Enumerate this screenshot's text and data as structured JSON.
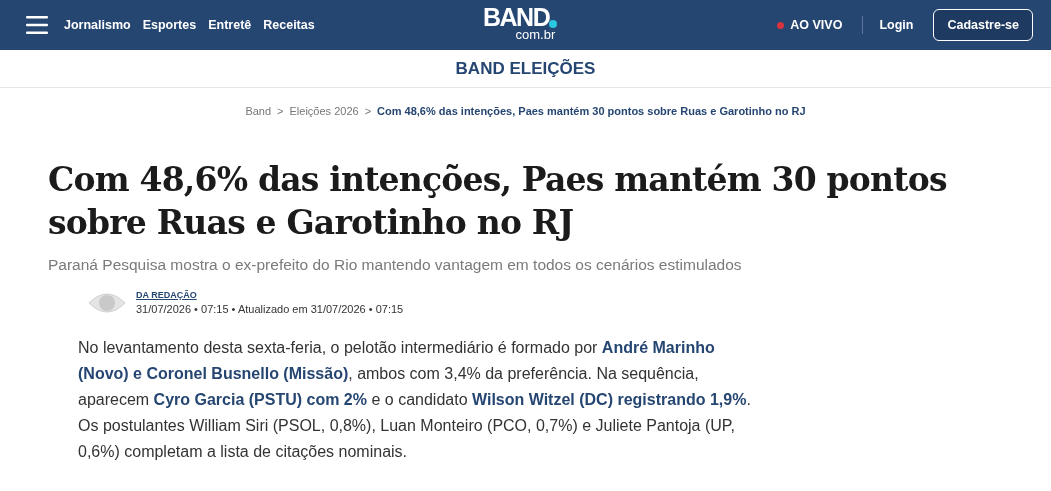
{
  "header": {
    "nav": [
      "Jornalismo",
      "Esportes",
      "Entretê",
      "Receitas"
    ],
    "logo": {
      "name": "BAND",
      "domain": "com.br"
    },
    "live": "AO VIVO",
    "login": "Login",
    "signup": "Cadastre-se"
  },
  "section": "BAND ELEIÇÕES",
  "breadcrumb": [
    {
      "label": "Band",
      "current": false
    },
    {
      "label": "Eleições 2026",
      "current": false
    },
    {
      "label": "Com 48,6% das intenções, Paes mantém 30 pontos sobre Ruas e Garotinho no RJ",
      "current": true
    }
  ],
  "breadcrumb_separator": ">",
  "article": {
    "title": "Com 48,6% das intenções, Paes mantém 30 pontos sobre Ruas e Garotinho no RJ",
    "subtitle": "Paraná Pesquisa mostra o ex-prefeito do Rio mantendo vantagem em todos os cenários estimulados",
    "author": "DA REDAÇÃO",
    "dates": "31/07/2026 • 07:15 • Atualizado em 31/07/2026 • 07:15",
    "body": "No levantamento desta sexta-feria, o pelotão intermediário é formado por **André Marinho (Novo) e Coronel Busnello (Missão)**, ambos com 3,4% da preferência. Na sequência, aparecem **Cyro Garcia (PSTU) com 2%** e o candidato **Wilson Witzel (DC) registrando 1,9%**. Os postulantes William Siri (PSOL, 0,8%), Luan Monteiro (PCO, 0,7%) e Juliete Pantoja (UP, 0,6%) completam a lista de citações nominais."
  }
}
